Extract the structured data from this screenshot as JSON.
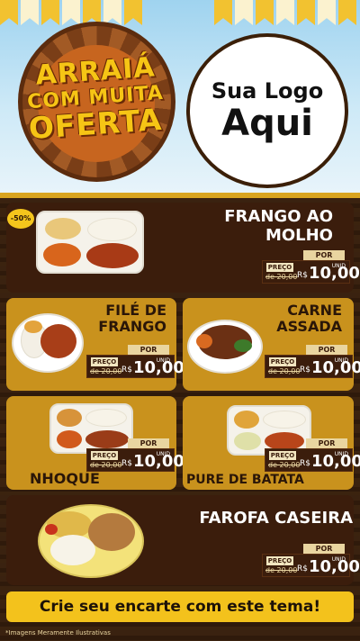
{
  "header": {
    "badge": {
      "line1": "ARRAIÁ",
      "line2": "COM MUITA",
      "line3": "OFERTA"
    },
    "logo": {
      "line1": "Sua Logo",
      "line2": "Aqui"
    }
  },
  "sale_badge": "-50%",
  "products": [
    {
      "name_l1": "FRANGO AO",
      "name_l2": "MOLHO",
      "por": "POR",
      "preco": "PREÇO",
      "de_price": "de 20,00",
      "currency": "R$",
      "price": "10,00",
      "unit": "UNID"
    },
    {
      "name_l1": "FILÉ DE",
      "name_l2": "FRANGO",
      "por": "POR",
      "preco": "PREÇO",
      "de_price": "de 20,00",
      "currency": "R$",
      "price": "10,00",
      "unit": "UNID"
    },
    {
      "name_l1": "CARNE",
      "name_l2": "ASSADA",
      "por": "POR",
      "preco": "PREÇO",
      "de_price": "de 20,00",
      "currency": "R$",
      "price": "10,00",
      "unit": "UNID"
    },
    {
      "name_l1": "NHOQUE",
      "name_l2": "",
      "por": "POR",
      "preco": "PREÇO",
      "de_price": "de 20,00",
      "currency": "R$",
      "price": "10,00",
      "unit": "UNID"
    },
    {
      "name_l1": "PURE DE BATATA",
      "name_l2": "",
      "por": "POR",
      "preco": "PREÇO",
      "de_price": "de 20,00",
      "currency": "R$",
      "price": "10,00",
      "unit": "UNID"
    },
    {
      "name_l1": "FAROFA CASEIRA",
      "name_l2": "",
      "por": "POR",
      "preco": "PREÇO",
      "de_price": "de 20,00",
      "currency": "R$",
      "price": "10,00",
      "unit": "UNID"
    }
  ],
  "cta": "Crie seu encarte com este tema!",
  "disclaimer": "*Imagens Meramente Ilustrativas",
  "colors": {
    "gold": "#c9921d",
    "brown": "#3b1d0c",
    "yellow": "#f3c21c"
  }
}
